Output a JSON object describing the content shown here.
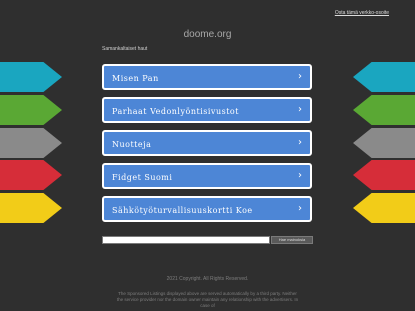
{
  "header": {
    "buy_link": "Osta tämä verkko-osoite",
    "domain": "doome.org"
  },
  "related_label": "Samankaltaiset haut",
  "colors": {
    "background": "#2f2f2f",
    "button": "#4d86d6",
    "ribbons": [
      "#1aa6c0",
      "#5aa834",
      "#8a8a8a",
      "#d62d39",
      "#f2cc18"
    ]
  },
  "links": [
    {
      "label": "Misen Pan",
      "icon": "chevron-right-icon"
    },
    {
      "label": "Parhaat Vedonlyöntisivustot",
      "icon": "chevron-right-icon"
    },
    {
      "label": "Nuotteja",
      "icon": "chevron-right-icon"
    },
    {
      "label": "Fidget Suomi",
      "icon": "chevron-right-icon"
    },
    {
      "label": "Sähkötyöturvallisuuskortti Koe",
      "icon": "chevron-right-icon"
    }
  ],
  "chevron": "›",
  "search": {
    "value": "",
    "button_label": "Hae mainoksia"
  },
  "footer": {
    "copyright": "2021 Copyright. All Rights Reserved.",
    "disclaimer": "The Sponsored Listings displayed above are served automatically by a third party. Neither the service provider nor the domain owner maintain any relationship with the advertisers. In case of"
  }
}
